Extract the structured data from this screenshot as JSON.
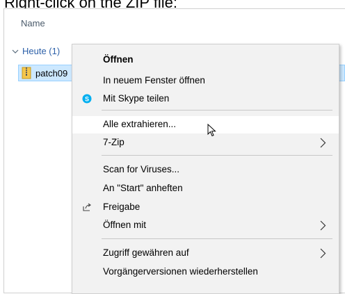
{
  "caption": "Right-click on the ZIP file:",
  "explorer": {
    "column_header": "Name",
    "group_label": "Heute (1)",
    "file_name": "patch09"
  },
  "context_menu": {
    "items": [
      {
        "label": "Öffnen",
        "bold": true
      },
      {
        "label": "In neuem Fenster öffnen"
      },
      {
        "label": "Mit Skype teilen",
        "icon": "skype-icon"
      },
      {
        "label": "Alle extrahieren...",
        "highlighted": true
      },
      {
        "label": "7-Zip",
        "submenu": true
      },
      {
        "label": "Scan for Viruses..."
      },
      {
        "label": "An \"Start\" anheften"
      },
      {
        "label": "Freigabe",
        "icon": "share-icon"
      },
      {
        "label": "Öffnen mit",
        "submenu": true
      },
      {
        "label": "Zugriff gewähren auf",
        "submenu": true
      },
      {
        "label": "Vorgängerversionen wiederherstellen"
      }
    ]
  },
  "colors": {
    "selection_fill": "#cce8ff",
    "selection_border": "#99d1ff",
    "menu_background": "#f2f2f2",
    "menu_hover": "#ffffff",
    "group_link": "#2b5fa8",
    "skype_blue": "#00aff0"
  }
}
